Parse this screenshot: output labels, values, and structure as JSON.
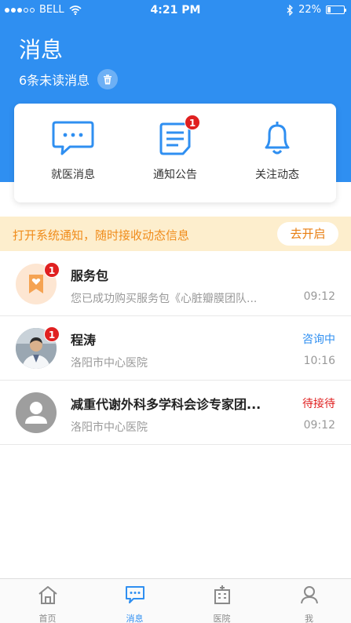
{
  "status_bar": {
    "carrier": "BELL",
    "time": "4:21 PM",
    "battery": "22%"
  },
  "header": {
    "title": "消息",
    "unread": "6条未读消息"
  },
  "quick_actions": [
    {
      "label": "就医消息",
      "icon": "chat-bubble-icon",
      "badge": ""
    },
    {
      "label": "通知公告",
      "icon": "notice-document-icon",
      "badge": "1"
    },
    {
      "label": "关注动态",
      "icon": "bell-icon",
      "badge": ""
    }
  ],
  "notice": {
    "text": "打开系统通知，随时接收动态信息",
    "button": "去开启"
  },
  "messages": [
    {
      "name": "服务包",
      "subtitle": "您已成功购买服务包《心脏瓣膜团队...",
      "status": "",
      "time": "09:12",
      "badge": "1"
    },
    {
      "name": "程涛",
      "subtitle": "洛阳市中心医院",
      "status": "咨询中",
      "time": "10:16",
      "badge": "1"
    },
    {
      "name": "减重代谢外科多学科会诊专家团...",
      "subtitle": "洛阳市中心医院",
      "status": "待接待",
      "time": "09:12",
      "badge": ""
    }
  ],
  "tabs": [
    {
      "label": "首页",
      "icon": "home-icon"
    },
    {
      "label": "消息",
      "icon": "message-icon"
    },
    {
      "label": "医院",
      "icon": "hospital-icon"
    },
    {
      "label": "我",
      "icon": "profile-icon"
    }
  ],
  "colors": {
    "primary": "#2f8ff1",
    "badge": "#e02020",
    "consulting": "#2f8ff1",
    "waiting": "#e02020",
    "notice_bg": "#fdeecd",
    "notice_text": "#f08c1b"
  }
}
